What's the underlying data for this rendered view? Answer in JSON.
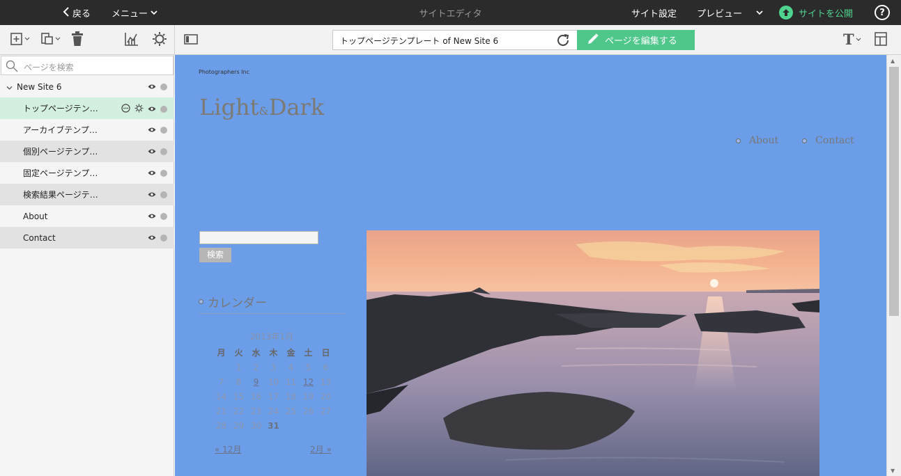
{
  "topbar": {
    "back_label": "戻る",
    "menu_label": "メニュー",
    "title": "サイトエディタ",
    "settings_label": "サイト設定",
    "preview_label": "プレビュー",
    "publish_label": "サイトを公開",
    "help_label": "?"
  },
  "toolbar": {
    "url_value": "トップページテンプレート of New Site 6",
    "edit_label": "ページを編集する"
  },
  "sidebar": {
    "search_placeholder": "ページを検索",
    "site_name": "New Site 6",
    "pages": [
      {
        "label": "トップページテン…"
      },
      {
        "label": "アーカイブテンプ…"
      },
      {
        "label": "個別ページテンプ…"
      },
      {
        "label": "固定ページテンプ…"
      },
      {
        "label": "検索結果ページテ…"
      },
      {
        "label": "About"
      },
      {
        "label": "Contact"
      }
    ]
  },
  "preview": {
    "company": "Photographers Inc",
    "logo_light": "Light",
    "logo_amp": "&",
    "logo_dark": "Dark",
    "nav": [
      {
        "label": "About"
      },
      {
        "label": "Contact"
      }
    ],
    "search_button": "検索",
    "calendar": {
      "heading": "カレンダー",
      "caption": "2013年1月",
      "weekdays": [
        "月",
        "火",
        "水",
        "木",
        "金",
        "土",
        "日"
      ],
      "rows": [
        [
          "",
          "1",
          "2",
          "3",
          "4",
          "5",
          "6"
        ],
        [
          "7",
          "8",
          "9",
          "10",
          "11",
          "12",
          "13"
        ],
        [
          "14",
          "15",
          "16",
          "17",
          "18",
          "19",
          "20"
        ],
        [
          "21",
          "22",
          "23",
          "24",
          "25",
          "26",
          "27"
        ],
        [
          "28",
          "29",
          "30",
          "31",
          "",
          "",
          ""
        ]
      ],
      "linked_days": [
        "9",
        "12"
      ],
      "today": "31",
      "prev": "« 12月",
      "next": "2月 »"
    }
  },
  "colors": {
    "preview_bg": "#6b9de8",
    "accent_green": "#4fc78a",
    "topbar_bg": "#2b2b2b",
    "selected_row": "#d3efe0"
  }
}
